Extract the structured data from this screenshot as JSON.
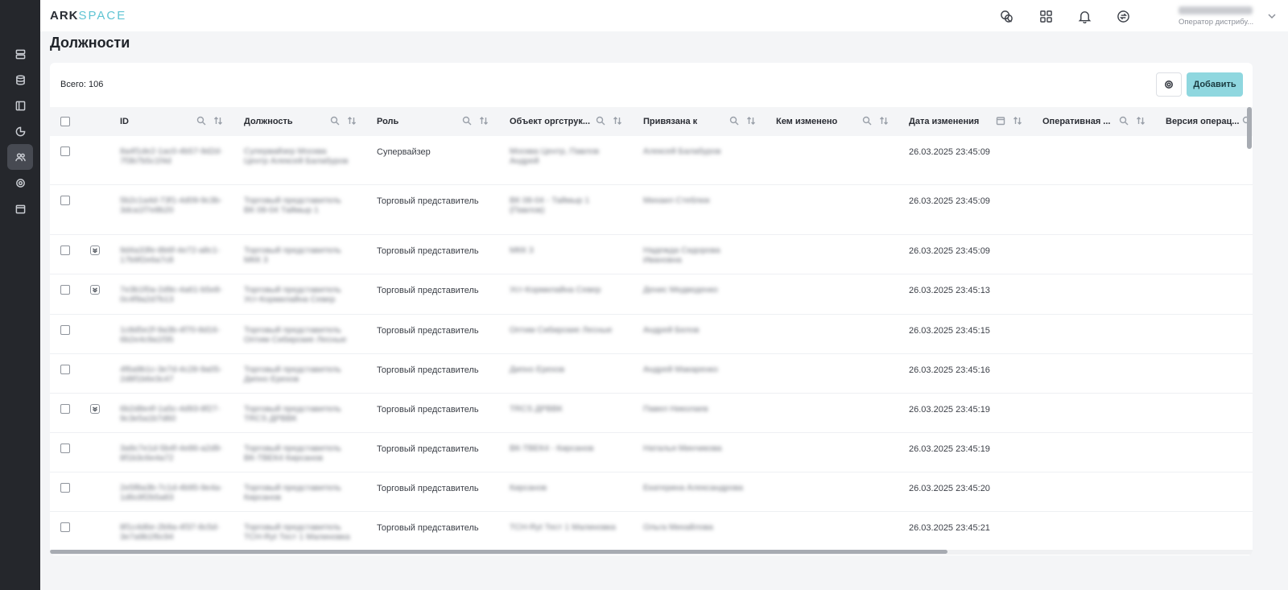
{
  "app": {
    "logo_part1": "ARK",
    "logo_part2": "SPACE"
  },
  "user": {
    "name": "██████████",
    "role": "Оператор дистрибу..."
  },
  "page": {
    "title": "Должности"
  },
  "toolbar": {
    "total": "Всего: 106",
    "add_label": "Добавить"
  },
  "columns": [
    {
      "label": "ID"
    },
    {
      "label": "Должность"
    },
    {
      "label": "Роль"
    },
    {
      "label": "Объект оргструк..."
    },
    {
      "label": "Привязана к"
    },
    {
      "label": "Кем изменено"
    },
    {
      "label": "Дата изменения"
    },
    {
      "label": "Оперативная ..."
    },
    {
      "label": "Версия операц..."
    }
  ],
  "rows": [
    {
      "id": "8a4f1de2-1ac0-4b57-9d2d-7f3b7b5c1f4d",
      "position": "Супервайзер Москва Центр Алексей Балабуров",
      "role": "Супервайзер",
      "org": "Москва Центр, Павлов Андрей",
      "bound": "Алексей Балабуров",
      "date": "26.03.2025 23:45:09",
      "expand": false
    },
    {
      "id": "5b2c1a4d-73f1-4d09-9c3b-3dca1f7e8b20",
      "position": "Торговый представитель ВК 08-04 Таймыр 1",
      "role": "Торговый представитель",
      "org": "ВК 08-04 - Таймыр 1 (Павлов)",
      "bound": "Михаил Стеблюк",
      "date": "26.03.2025 23:45:09",
      "expand": false
    },
    {
      "id": "9d4a33fe-8b6f-4e72-a8c1-17b9f2e6a7c8",
      "position": "Торговый представитель МКК 3",
      "role": "Торговый представитель",
      "org": "МКК 3",
      "bound": "Надежда Сидорова Ивановна",
      "date": "26.03.2025 23:45:09",
      "expand": true
    },
    {
      "id": "7e3b1f0a-2d9c-4a61-b5e8-0c4f9a2d7b13",
      "position": "Торговый представитель Уст-Кормилайна Север",
      "role": "Торговый представитель",
      "org": "Уст-Кормилайна Север",
      "bound": "Денис Медведенко",
      "date": "26.03.2025 23:45:13",
      "expand": true
    },
    {
      "id": "1c8d5e2f-9a3b-4f70-8d16-6b2e4c9a1f35",
      "position": "Торговый представитель Оптим Сибирские Лесные",
      "role": "Торговый представитель",
      "org": "Оптим Сибирские Лесные",
      "bound": "Андрей Белов",
      "date": "26.03.2025 23:45:15",
      "expand": false
    },
    {
      "id": "4f6a9b1c-3e7d-4c28-9a05-2d8f1b6e3c47",
      "position": "Торговый представитель Дипно Ерехов",
      "role": "Торговый представитель",
      "org": "Дипно Ерехов",
      "bound": "Андрей Макаренко",
      "date": "26.03.2025 23:45:16",
      "expand": false
    },
    {
      "id": "6b2d8e4f-1a5c-4d93-8f27-9c3e5a1b7d60",
      "position": "Торговый представитель TRCS ДРВВК",
      "role": "Торговый представитель",
      "org": "TRCS ДРВВК",
      "bound": "Павел Николаев",
      "date": "26.03.2025 23:45:19",
      "expand": true
    },
    {
      "id": "3a9c7e1d-5b4f-4e86-a2d9-8f1b3c6e4a72",
      "position": "Торговый представитель ВК-ТВЕК4 Кирсанов",
      "role": "Торговый представитель",
      "org": "ВК-ТВЕК4 - Кирсанов",
      "bound": "Наталья Минчикова",
      "date": "26.03.2025 23:45:19",
      "expand": false
    },
    {
      "id": "2e5f8a3b-7c1d-4b95-9e4a-1d6c8f2b5a83",
      "position": "Торговый представитель Кирсанов",
      "role": "Торговый представитель",
      "org": "Кирсанов",
      "bound": "Екатерина Александрова",
      "date": "26.03.2025 23:45:20",
      "expand": false
    },
    {
      "id": "8f1c4d6e-2b9a-4f37-8c5d-3e7a9b1f6c94",
      "position": "Торговый представитель TCH-Ryt Тест 1 Малиновка",
      "role": "Торговый представитель",
      "org": "TCH-Ryt Тест 1 Малиновка",
      "bound": "Ольга Михайлова",
      "date": "26.03.2025 23:45:21",
      "expand": false
    }
  ]
}
